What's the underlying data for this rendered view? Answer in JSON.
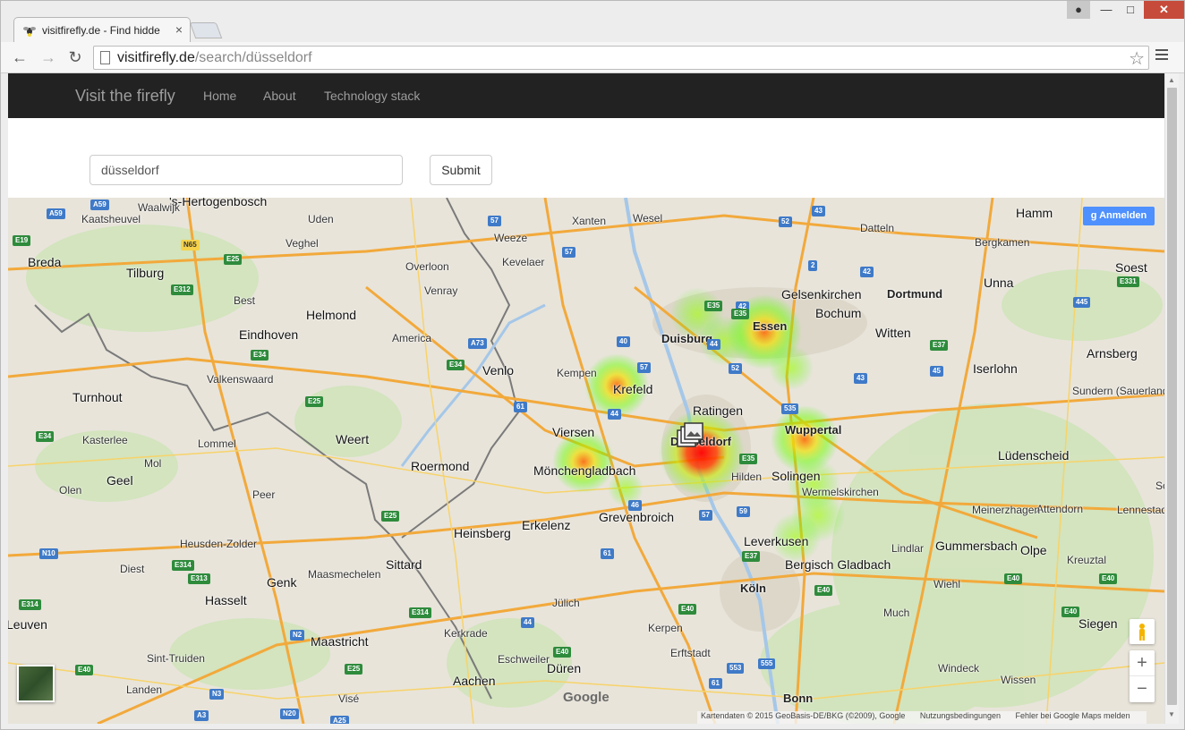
{
  "browser": {
    "tab_title": "visitfirefly.de - Find hidde",
    "url_host": "visitfirefly.de",
    "url_path": "/search/düsseldorf"
  },
  "site": {
    "brand": "Visit the firefly",
    "nav": [
      "Home",
      "About",
      "Technology stack"
    ]
  },
  "search": {
    "query": "düsseldorf",
    "submit_label": "Submit"
  },
  "map": {
    "signin_label": "Anmelden",
    "google_logo": "Google",
    "attribution": [
      "Kartendaten © 2015 GeoBasis-DE/BKG (©2009), Google",
      "Nutzungsbedingungen",
      "Fehler bei Google Maps melden"
    ],
    "zoom_in": "+",
    "zoom_out": "−",
    "places": [
      {
        "name": "'s-Hertogenbosch",
        "cls": "big"
      },
      {
        "name": "Waalwijk"
      },
      {
        "name": "Kaatsheuvel"
      },
      {
        "name": "Uden"
      },
      {
        "name": "Veghel"
      },
      {
        "name": "Xanten"
      },
      {
        "name": "Wesel"
      },
      {
        "name": "Weeze"
      },
      {
        "name": "Kevelaer"
      },
      {
        "name": "Overloon"
      },
      {
        "name": "Venray"
      },
      {
        "name": "Breda",
        "cls": "big"
      },
      {
        "name": "Tilburg",
        "cls": "big"
      },
      {
        "name": "Best"
      },
      {
        "name": "Helmond",
        "cls": "big"
      },
      {
        "name": "Eindhoven",
        "cls": "big"
      },
      {
        "name": "America"
      },
      {
        "name": "Venlo",
        "cls": "big"
      },
      {
        "name": "Valkenswaard"
      },
      {
        "name": "Turnhout",
        "cls": "big"
      },
      {
        "name": "Kasterlee"
      },
      {
        "name": "Lommel"
      },
      {
        "name": "Weert",
        "cls": "big"
      },
      {
        "name": "Mol"
      },
      {
        "name": "Geel",
        "cls": "big"
      },
      {
        "name": "Olen"
      },
      {
        "name": "Peer"
      },
      {
        "name": "Roermond",
        "cls": "big"
      },
      {
        "name": "Heusden-Zolder"
      },
      {
        "name": "Diest"
      },
      {
        "name": "Maasmechelen"
      },
      {
        "name": "Genk",
        "cls": "big"
      },
      {
        "name": "Hasselt",
        "cls": "big"
      },
      {
        "name": "Sittard",
        "cls": "big"
      },
      {
        "name": "Heinsberg",
        "cls": "big"
      },
      {
        "name": "Erkelenz",
        "cls": "big"
      },
      {
        "name": "Maastricht",
        "cls": "big"
      },
      {
        "name": "Kerkrade"
      },
      {
        "name": "Sint-Truiden"
      },
      {
        "name": "Landen"
      },
      {
        "name": "Visé"
      },
      {
        "name": "Aachen",
        "cls": "big"
      },
      {
        "name": "Eschweiler"
      },
      {
        "name": "Düren",
        "cls": "big"
      },
      {
        "name": "Jülich"
      },
      {
        "name": "Kerpen"
      },
      {
        "name": "Erftstadt"
      },
      {
        "name": "Kempen"
      },
      {
        "name": "Krefeld",
        "cls": "big"
      },
      {
        "name": "Viersen",
        "cls": "big"
      },
      {
        "name": "Mönchengladbach",
        "cls": "big"
      },
      {
        "name": "Grevenbroich",
        "cls": "big"
      },
      {
        "name": "Duisburg",
        "cls": "city"
      },
      {
        "name": "Ratingen",
        "cls": "big"
      },
      {
        "name": "Düsseldorf",
        "cls": "city"
      },
      {
        "name": "Hilden"
      },
      {
        "name": "Essen",
        "cls": "city"
      },
      {
        "name": "Gelsenkirchen",
        "cls": "big"
      },
      {
        "name": "Bochum",
        "cls": "big"
      },
      {
        "name": "Dortmund",
        "cls": "city"
      },
      {
        "name": "Witten",
        "cls": "big"
      },
      {
        "name": "Wuppertal",
        "cls": "city"
      },
      {
        "name": "Solingen",
        "cls": "big"
      },
      {
        "name": "Wermelskirchen"
      },
      {
        "name": "Leverkusen",
        "cls": "big"
      },
      {
        "name": "Bergisch Gladbach",
        "cls": "big"
      },
      {
        "name": "Köln",
        "cls": "city"
      },
      {
        "name": "Bonn",
        "cls": "city"
      },
      {
        "name": "Datteln"
      },
      {
        "name": "Hamm",
        "cls": "big"
      },
      {
        "name": "Bergkamen"
      },
      {
        "name": "Unna",
        "cls": "big"
      },
      {
        "name": "Soest",
        "cls": "big"
      },
      {
        "name": "Iserlohn",
        "cls": "big"
      },
      {
        "name": "Arnsberg",
        "cls": "big"
      },
      {
        "name": "Sundern (Sauerland)"
      },
      {
        "name": "Lüdenscheid",
        "cls": "big"
      },
      {
        "name": "Attendorn"
      },
      {
        "name": "Meinerzhagen"
      },
      {
        "name": "Lennestadt"
      },
      {
        "name": "Gummersbach",
        "cls": "big"
      },
      {
        "name": "Lindlar"
      },
      {
        "name": "Olpe",
        "cls": "big"
      },
      {
        "name": "Kreuztal"
      },
      {
        "name": "Wiehl"
      },
      {
        "name": "Much"
      },
      {
        "name": "Siegen",
        "cls": "big"
      },
      {
        "name": "Windeck"
      },
      {
        "name": "Wissen"
      },
      {
        "name": "Leuven",
        "cls": "big"
      },
      {
        "name": "Sc"
      }
    ],
    "shields": [
      {
        "t": "A59",
        "k": "a"
      },
      {
        "t": "A59",
        "k": "a"
      },
      {
        "t": "E19",
        "k": "e"
      },
      {
        "t": "N65",
        "k": "n"
      },
      {
        "t": "E25",
        "k": "e"
      },
      {
        "t": "E312",
        "k": "e"
      },
      {
        "t": "E34",
        "k": "e"
      },
      {
        "t": "A73",
        "k": "a"
      },
      {
        "t": "E34",
        "k": "e"
      },
      {
        "t": "E25",
        "k": "e"
      },
      {
        "t": "E34",
        "k": "e"
      },
      {
        "t": "E25",
        "k": "e"
      },
      {
        "t": "N10",
        "k": "a"
      },
      {
        "t": "E314",
        "k": "e"
      },
      {
        "t": "E313",
        "k": "e"
      },
      {
        "t": "E314",
        "k": "e"
      },
      {
        "t": "E314",
        "k": "e"
      },
      {
        "t": "N2",
        "k": "a"
      },
      {
        "t": "E25",
        "k": "e"
      },
      {
        "t": "E40",
        "k": "e"
      },
      {
        "t": "N3",
        "k": "a"
      },
      {
        "t": "N20",
        "k": "a"
      },
      {
        "t": "A3",
        "k": "a"
      },
      {
        "t": "A25",
        "k": "a"
      },
      {
        "t": "57",
        "k": "a"
      },
      {
        "t": "57",
        "k": "a"
      },
      {
        "t": "52",
        "k": "a"
      },
      {
        "t": "43",
        "k": "a"
      },
      {
        "t": "2",
        "k": "a"
      },
      {
        "t": "42",
        "k": "a"
      },
      {
        "t": "42",
        "k": "a"
      },
      {
        "t": "40",
        "k": "a"
      },
      {
        "t": "57",
        "k": "a"
      },
      {
        "t": "44",
        "k": "a"
      },
      {
        "t": "52",
        "k": "a"
      },
      {
        "t": "44",
        "k": "a"
      },
      {
        "t": "61",
        "k": "a"
      },
      {
        "t": "43",
        "k": "a"
      },
      {
        "t": "45",
        "k": "a"
      },
      {
        "t": "535",
        "k": "a"
      },
      {
        "t": "E35",
        "k": "e"
      },
      {
        "t": "46",
        "k": "a"
      },
      {
        "t": "57",
        "k": "a"
      },
      {
        "t": "59",
        "k": "a"
      },
      {
        "t": "E37",
        "k": "e"
      },
      {
        "t": "61",
        "k": "a"
      },
      {
        "t": "44",
        "k": "a"
      },
      {
        "t": "E40",
        "k": "e"
      },
      {
        "t": "E40",
        "k": "e"
      },
      {
        "t": "553",
        "k": "a"
      },
      {
        "t": "555",
        "k": "a"
      },
      {
        "t": "61",
        "k": "a"
      },
      {
        "t": "E40",
        "k": "e"
      },
      {
        "t": "E37",
        "k": "e"
      },
      {
        "t": "445",
        "k": "a"
      },
      {
        "t": "E331",
        "k": "e"
      },
      {
        "t": "E40",
        "k": "e"
      },
      {
        "t": "E40",
        "k": "e"
      },
      {
        "t": "E40",
        "k": "e"
      },
      {
        "t": "E35",
        "k": "e"
      },
      {
        "t": "E35",
        "k": "e"
      }
    ],
    "marker_label": "photo-cluster"
  }
}
